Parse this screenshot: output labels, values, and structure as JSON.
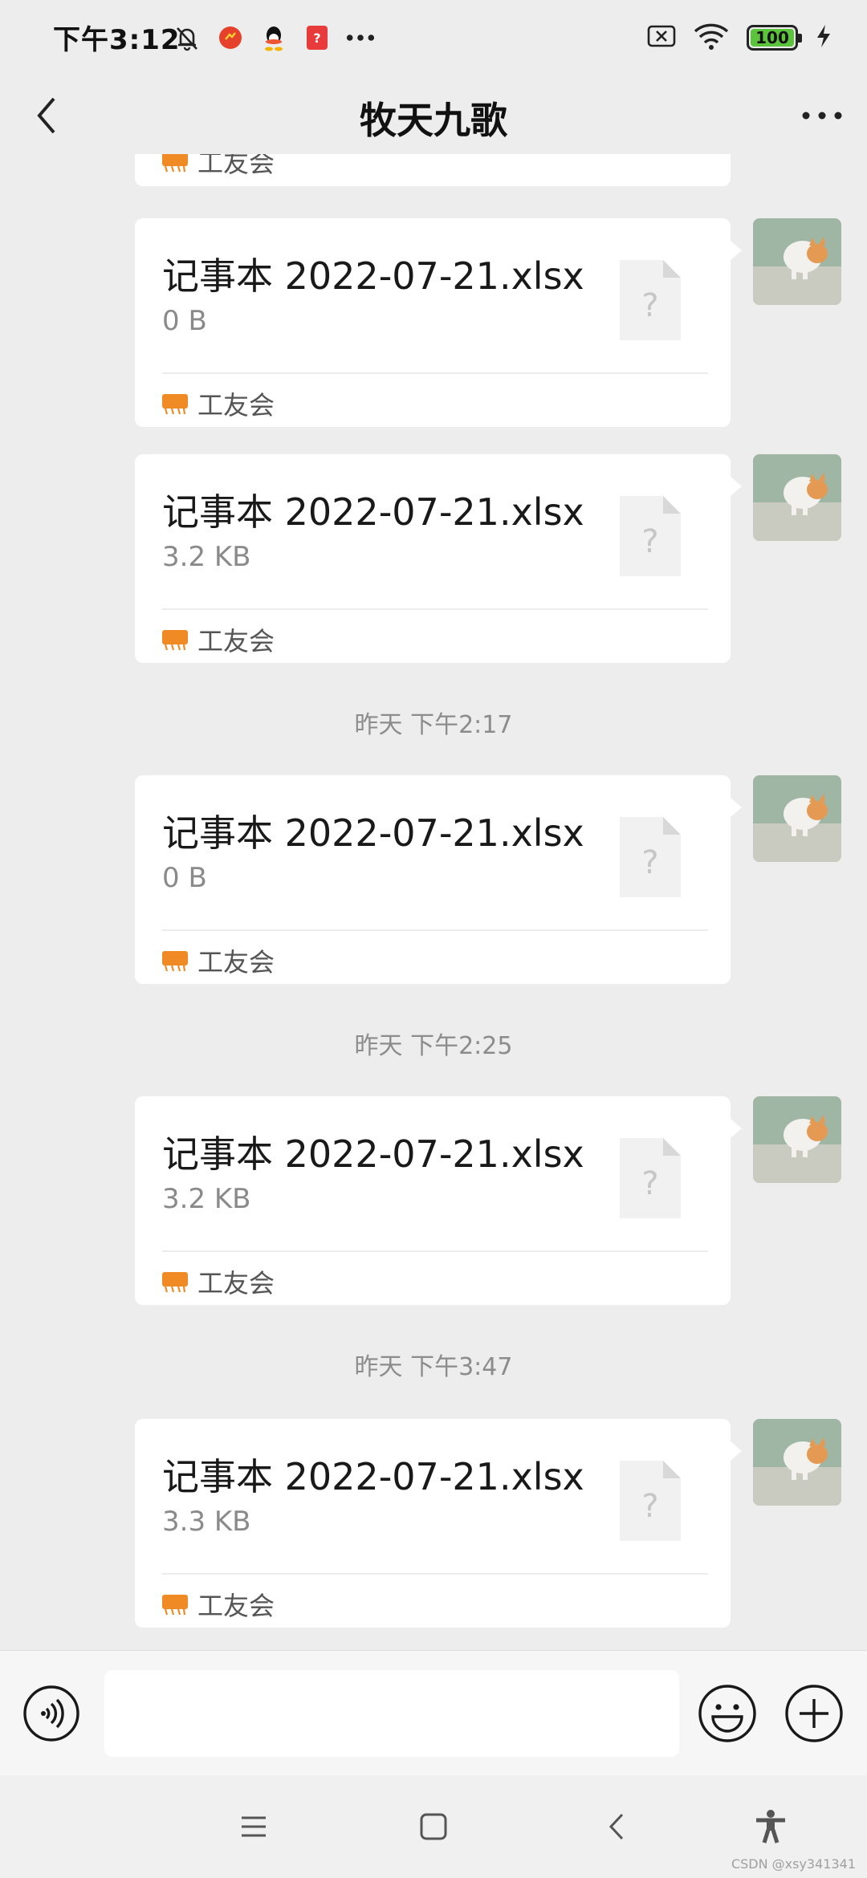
{
  "status_bar": {
    "time": "下午3:12",
    "battery_level": "100",
    "icons": [
      "notification-off-icon",
      "app-icon",
      "qq-icon",
      "app-icon",
      "more-dots-icon",
      "sim-off-icon",
      "wifi-icon",
      "battery-icon",
      "charging-icon"
    ]
  },
  "header": {
    "title": "牧天九歌"
  },
  "messages": [
    {
      "file_name": "记事本 2022-07-21.xlsx",
      "file_size": "0 B",
      "source": "工友会"
    },
    {
      "file_name": "记事本 2022-07-21.xlsx",
      "file_size": "3.2 KB",
      "source": "工友会"
    },
    {
      "timestamp": "昨天 下午2:17"
    },
    {
      "file_name": "记事本 2022-07-21.xlsx",
      "file_size": "0 B",
      "source": "工友会"
    },
    {
      "timestamp": "昨天 下午2:25"
    },
    {
      "file_name": "记事本 2022-07-21.xlsx",
      "file_size": "3.2 KB",
      "source": "工友会"
    },
    {
      "timestamp": "昨天 下午3:47"
    },
    {
      "file_name": "记事本 2022-07-21.xlsx",
      "file_size": "3.3 KB",
      "source": "工友会"
    }
  ],
  "partial_top": {
    "source": "工友会"
  },
  "input": {
    "value": "",
    "placeholder": ""
  },
  "watermark": "CSDN @xsy341341",
  "colors": {
    "background": "#ededed",
    "bubble": "#ffffff",
    "source_logo": "#f08a24",
    "battery_fill": "#5cc33c"
  }
}
